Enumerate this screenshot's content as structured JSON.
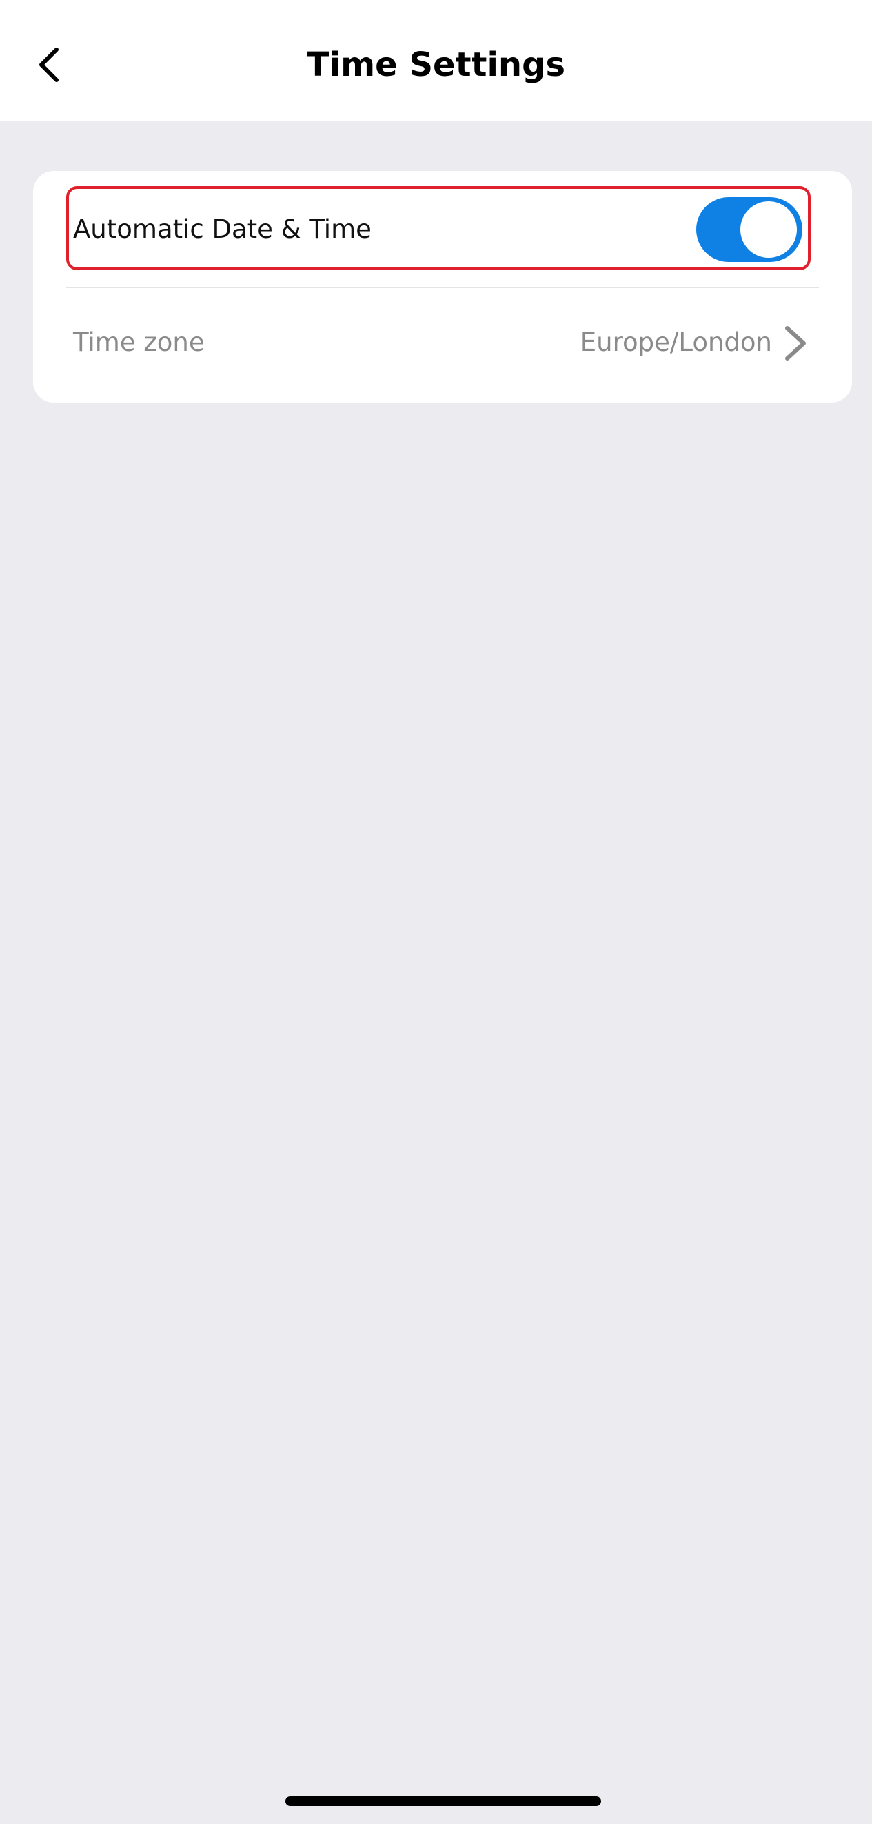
{
  "header": {
    "title": "Time Settings",
    "back_icon": "chevron-left-icon"
  },
  "settings": {
    "automatic": {
      "label": "Automatic Date & Time",
      "enabled": true,
      "toggle_color": "#1081E4",
      "highlight_color": "#E0202C"
    },
    "time_zone": {
      "label": "Time zone",
      "value": "Europe/London",
      "icon": "chevron-right-icon"
    }
  },
  "colors": {
    "background": "#ECEBF0",
    "card": "#FFFFFF",
    "secondary_text": "#8A8A8A"
  }
}
